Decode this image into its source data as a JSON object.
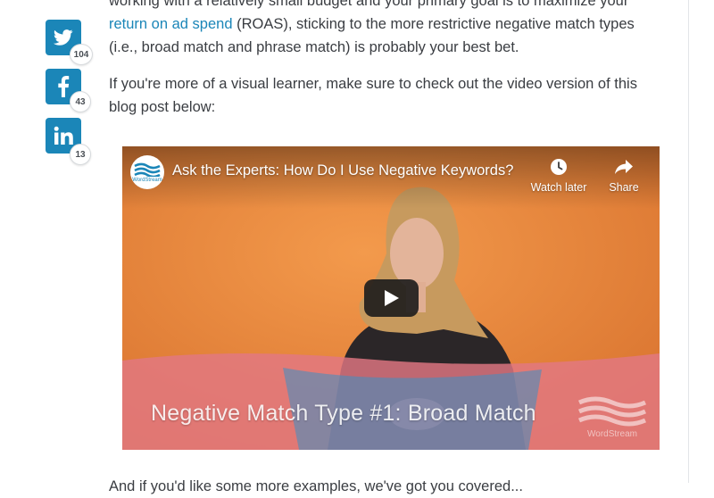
{
  "article": {
    "para1_line1": "working with a relatively small budget and your primary goal is to maximize your",
    "para1_link": "return on ad spend",
    "para1_rest_a": " (ROAS), sticking to the more restrictive negative match types",
    "para1_rest_b": "(i.e., broad match and phrase match) is probably your best bet.",
    "para2": "If you're more of a visual learner, make sure to check out the video version of this blog post below:",
    "para3": "And if you'd like some more examples, we've got you covered..."
  },
  "share": {
    "twitter": {
      "icon": "twitter-icon",
      "count": "104"
    },
    "facebook": {
      "icon": "facebook-icon",
      "count": "43"
    },
    "linkedin": {
      "icon": "linkedin-icon",
      "count": "13"
    },
    "accent": "#1b86b8"
  },
  "video": {
    "title": "Ask the Experts: How Do I Use Negative Keywords?",
    "channel_logo_text": "WordStream",
    "watch_later_label": "Watch later",
    "share_label": "Share",
    "caption": "Negative Match Type #1: Broad Match",
    "watermark_text": "WordStream",
    "colors": {
      "background": "#e0843d",
      "band": "#3a8fc4"
    }
  }
}
